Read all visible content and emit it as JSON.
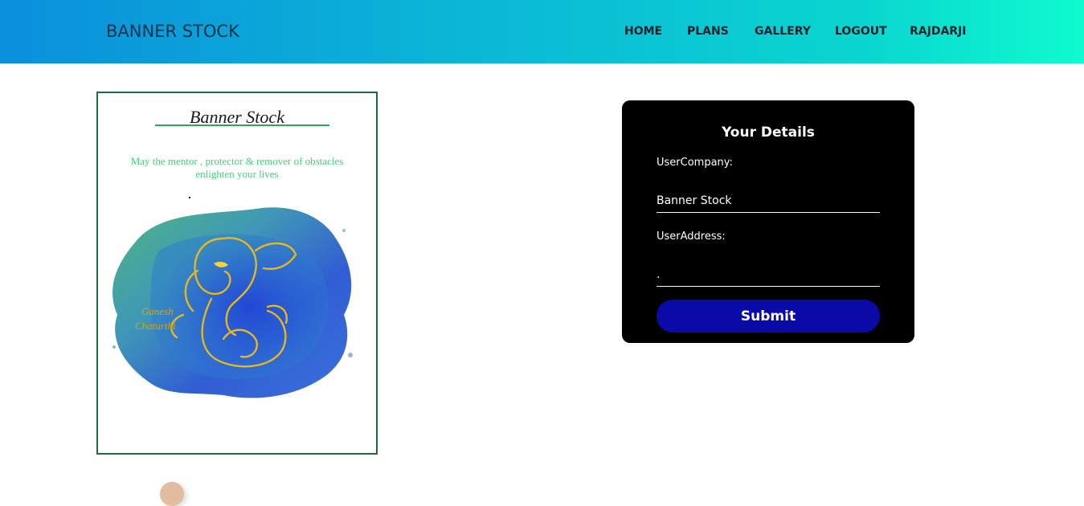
{
  "header": {
    "brand": "BANNER STOCK",
    "nav": [
      {
        "label": "HOME"
      },
      {
        "label": "PLANS"
      },
      {
        "label": "GALLERY"
      },
      {
        "label": "LOGOUT"
      },
      {
        "label": "RAJDARJI"
      }
    ],
    "gradient_colors": [
      "#0b8fdc",
      "#0ffbd0"
    ]
  },
  "banner": {
    "title": "Banner Stock",
    "wish_line_1": "May the mentor , protector & remover of obstacles",
    "wish_line_2": "enlighten your lives",
    "artwork": "ganesh-chaturthi-watercolor-illustration",
    "border_color": "#1f6b3c"
  },
  "form": {
    "title": "Your Details",
    "company_label": "UserCompany:",
    "company_value": "Banner Stock",
    "address_label": "UserAddress:",
    "address_value": ".",
    "submit_label": "Submit",
    "button_color": "#0a0aa8"
  },
  "floating_widget": {
    "icon": "avatar-icon"
  }
}
